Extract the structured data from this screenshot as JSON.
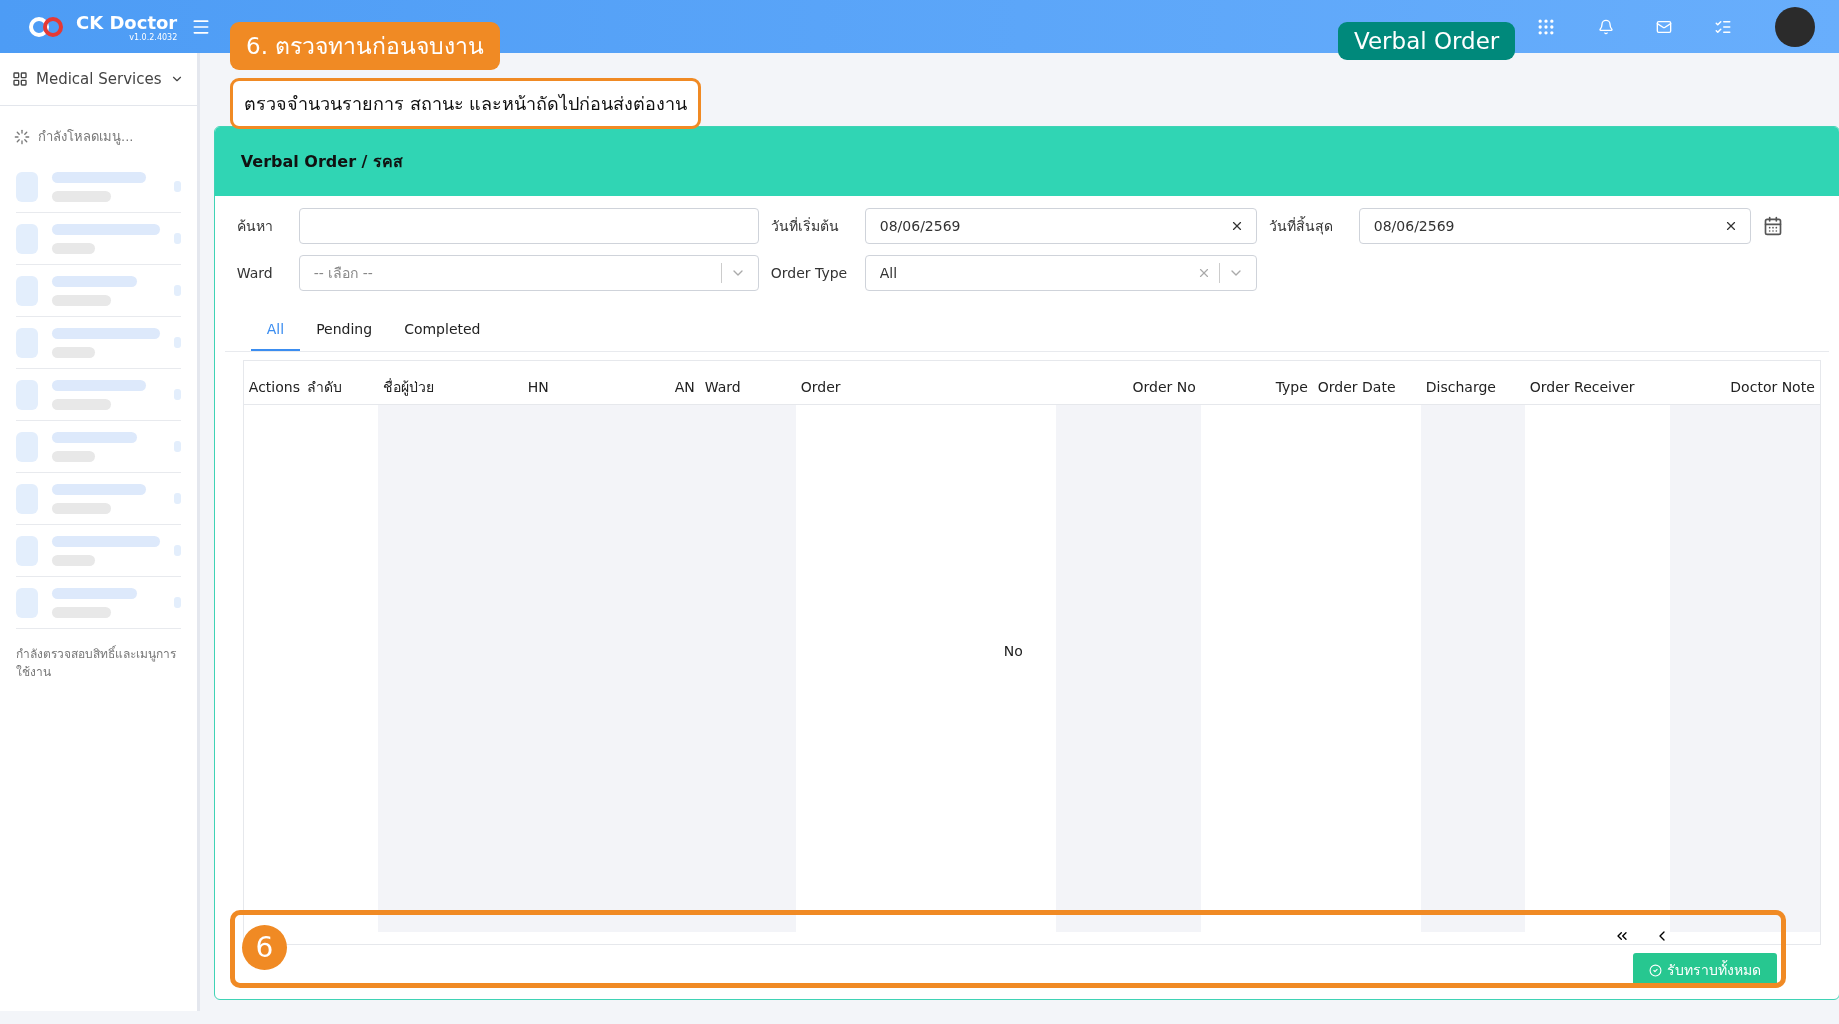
{
  "header": {
    "brand": "CK Doctor",
    "version": "v1.0.2.4032"
  },
  "sidebar": {
    "module": "Medical Services",
    "loading_text": "กำลังโหลดเมนู...",
    "footer_text": "กำลังตรวจสอบสิทธิ์และเมนูการใช้งาน"
  },
  "annotations": {
    "step_badge": "6. ตรวจทานก่อนจบงาน",
    "instruction": "ตรวจจำนวนรายการ สถานะ และหน้าถัดไปก่อนส่งต่องาน",
    "page_badge": "Verbal Order",
    "marker": "6"
  },
  "card": {
    "title": "Verbal Order / รคส"
  },
  "filters": {
    "search_label": "ค้นหา",
    "start_label": "วันที่เริ่มต้น",
    "start_value": "08/06/2569",
    "end_label": "วันที่สิ้นสุด",
    "end_value": "08/06/2569",
    "ward_label": "Ward",
    "ward_placeholder": "-- เลือก --",
    "type_label": "Order Type",
    "type_value": "All"
  },
  "tabs": [
    {
      "label": "All",
      "selected": true
    },
    {
      "label": "Pending",
      "selected": false
    },
    {
      "label": "Completed",
      "selected": false
    }
  ],
  "table": {
    "columns": [
      {
        "label": "Actions",
        "shaded": false
      },
      {
        "label": "ลำดับ",
        "shaded": false
      },
      {
        "label": "ชื่อผู้ป่วย",
        "shaded": true
      },
      {
        "label": "HN",
        "shaded": true
      },
      {
        "label": "AN",
        "shaded": true
      },
      {
        "label": "Ward",
        "shaded": true
      },
      {
        "label": "Order",
        "shaded": false
      },
      {
        "label": "Order No",
        "shaded": true
      },
      {
        "label": "Type",
        "shaded": false
      },
      {
        "label": "Order Date",
        "shaded": false
      },
      {
        "label": "Discharge",
        "shaded": true
      },
      {
        "label": "Order Receiver",
        "shaded": false
      },
      {
        "label": "Doctor Note",
        "shaded": true
      }
    ],
    "empty_text": "No"
  },
  "footer": {
    "acknowledge_button": "รับทราบทั้งหมด"
  }
}
